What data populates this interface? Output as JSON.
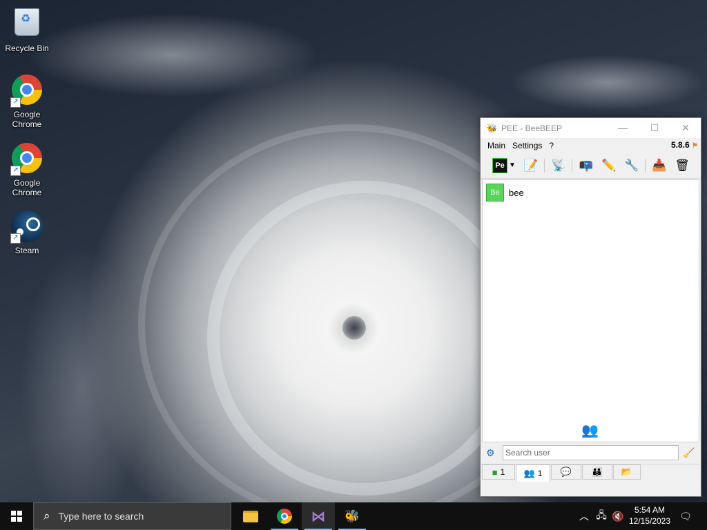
{
  "desktop": {
    "icons": [
      {
        "label": "Recycle Bin",
        "icon": "recycle-bin-icon"
      },
      {
        "label": "Google\nChrome",
        "line1": "Google",
        "line2": "Chrome",
        "icon": "chrome-icon"
      },
      {
        "label": "Google\nChrome",
        "line1": "Google",
        "line2": "Chrome",
        "icon": "chrome-icon"
      },
      {
        "label": "Steam",
        "icon": "steam-icon"
      }
    ]
  },
  "window": {
    "title": "PEE - BeeBEEP",
    "controls": {
      "minimize": "—",
      "maximize": "☐",
      "close": "✕"
    },
    "menu": [
      "Main",
      "Settings",
      "?"
    ],
    "version": "5.8.6",
    "toolbar": {
      "status_badge": "Pe"
    },
    "users": [
      {
        "avatar_text": "Be",
        "name": "bee",
        "status_color": "#5bd45b"
      }
    ],
    "search": {
      "placeholder": "Search user",
      "value": ""
    },
    "tabs": [
      {
        "icon": "user-status-icon",
        "count": "1"
      },
      {
        "icon": "users-icon",
        "count": "1"
      },
      {
        "icon": "chats-icon",
        "count": ""
      },
      {
        "icon": "groups-icon",
        "count": ""
      },
      {
        "icon": "file-sharing-icon",
        "count": ""
      }
    ]
  },
  "taskbar": {
    "search_placeholder": "Type here to search",
    "apps": [
      "file-explorer-icon",
      "chrome-icon",
      "visual-studio-icon",
      "beebeep-icon"
    ],
    "clock": {
      "time": "5:54 AM",
      "date": "12/15/2023"
    }
  },
  "colors": {
    "accent": "#76b9ed",
    "online": "#5bd45b",
    "taskbar": "#101010"
  }
}
